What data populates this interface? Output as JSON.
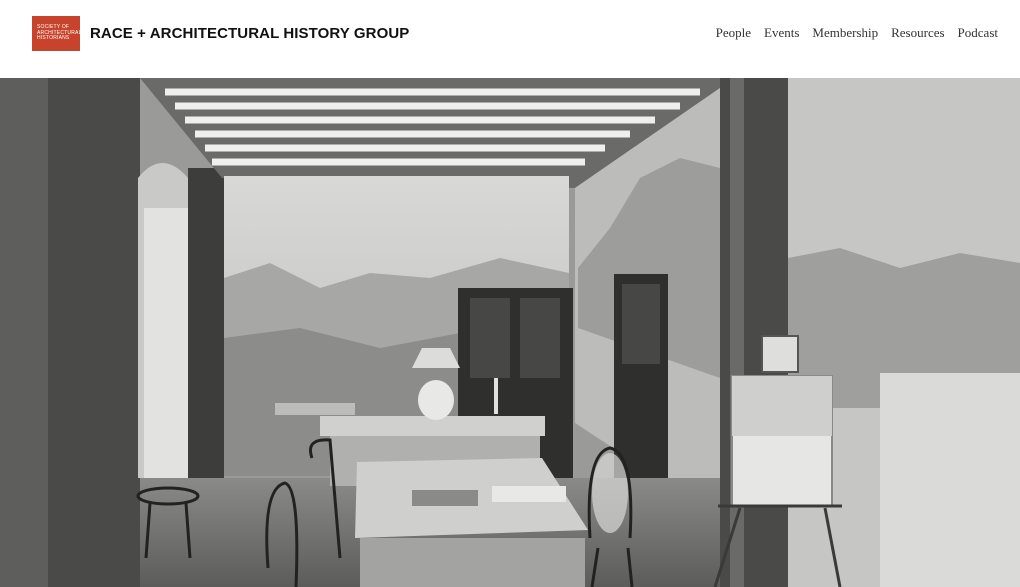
{
  "header": {
    "logo_text": "SOCIETY OF\nARCHITECTURAL\nHISTORIANS",
    "title": "RACE + ARCHITECTURAL HISTORY GROUP"
  },
  "nav": {
    "items": [
      "People",
      "Events",
      "Membership",
      "Resources",
      "Podcast"
    ]
  },
  "colors": {
    "brand_red": "#c8432b",
    "nav_text": "#333333",
    "title_text": "#111111"
  }
}
